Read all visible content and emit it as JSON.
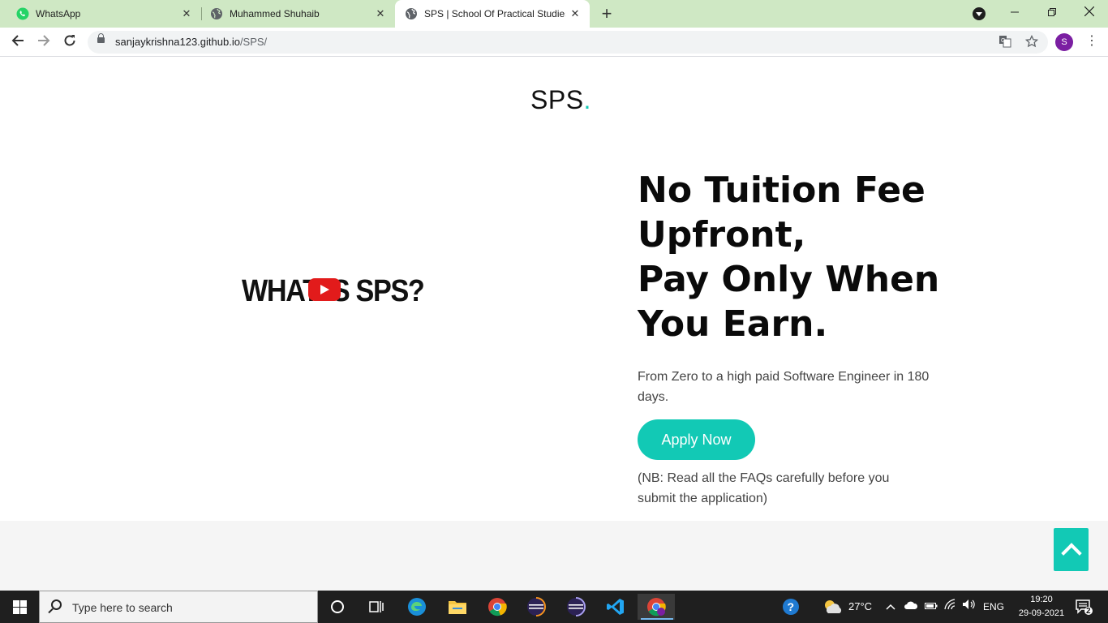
{
  "browser": {
    "tabs": [
      {
        "title": "WhatsApp",
        "favicon": "whatsapp-icon"
      },
      {
        "title": "Muhammed Shuhaib",
        "favicon": "globe-icon"
      },
      {
        "title": "SPS | School Of Practical Studies",
        "favicon": "globe-icon",
        "active": true
      }
    ],
    "close_glyph": "✕",
    "new_tab_glyph": "+",
    "url_host": "sanjaykrishna123.github.io",
    "url_path": "/SPS/",
    "profile_initial": "S",
    "menu_glyph": "⋮"
  },
  "page": {
    "logo_text": "SPS",
    "logo_dot": ".",
    "video_title": "WHAT IS SPS?",
    "headline": [
      "No Tuition Fee",
      "Upfront,",
      "Pay Only When",
      "You Earn."
    ],
    "subtext": "From Zero to a high paid Software Engineer in 180 days.",
    "apply_label": "Apply Now",
    "note": "(NB: Read all the FAQs carefully before you submit the application)",
    "accent_color": "#12c9b5"
  },
  "taskbar": {
    "search_placeholder": "Type here to search",
    "weather": "27°C",
    "language": "ENG",
    "time": "19:20",
    "date": "29-09-2021",
    "notification_count": "2"
  }
}
